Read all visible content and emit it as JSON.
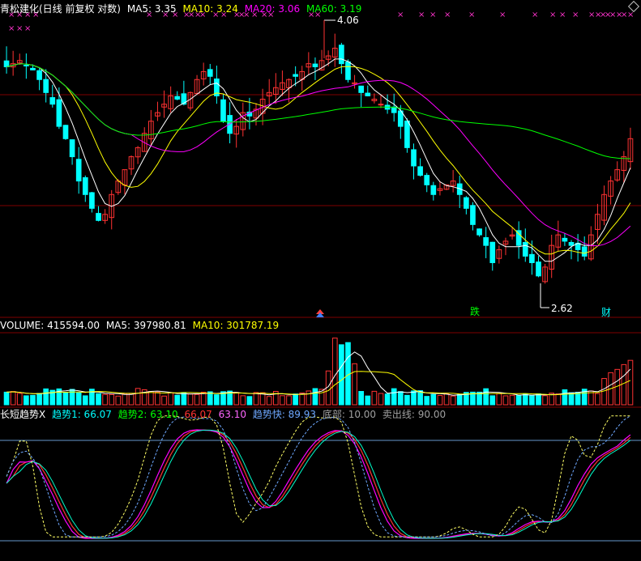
{
  "header": {
    "title": "青松建化(日线 前复权 对数)",
    "ma5": "MA5: 3.35",
    "ma10": "MA10: 3.24",
    "ma20": "MA20: 3.06",
    "ma60": "MA60: 3.19"
  },
  "volume_header": {
    "label": "VOLUME: 415594.00",
    "ma5": "MA5: 397980.81",
    "ma10": "MA10: 301787.19"
  },
  "indicator_header": {
    "name": "长短趋势X",
    "t1": "趋势1: 66.07",
    "t2": "趋势2: 63.10",
    "v1": "66.07",
    "v2": "63.10",
    "fast": "趋势快: 89.93",
    "bottom": "底部: 10.00",
    "sell": "卖出线: 90.00"
  },
  "annotations": {
    "high": "4.06",
    "low": "2.62",
    "die": "跌",
    "cai": "财"
  },
  "colors": {
    "up": "#ff3232",
    "down": "#00ffff",
    "ma5": "#ffffff",
    "ma10": "#ffff00",
    "ma20": "#ff00ff",
    "ma60": "#00ff00",
    "grid": "#800000"
  },
  "chart_data": {
    "type": "candlestick",
    "price_high": 4.06,
    "price_low": 2.62,
    "x_ticks": 120,
    "indicator_levels": {
      "bottom": 10,
      "sell": 90
    },
    "last_values": {
      "ma5": 3.35,
      "ma10": 3.24,
      "ma20": 3.06,
      "ma60": 3.19,
      "volume": 415594.0,
      "vol_ma5": 397980.81,
      "vol_ma10": 301787.19,
      "trend1": 66.07,
      "trend2": 63.1,
      "trend_fast": 89.93
    },
    "closes": [
      3.78,
      3.8,
      3.82,
      3.79,
      3.76,
      3.7,
      3.62,
      3.55,
      3.42,
      3.35,
      3.25,
      3.12,
      3.05,
      2.98,
      2.92,
      2.95,
      3.05,
      3.12,
      3.18,
      3.25,
      3.3,
      3.38,
      3.45,
      3.5,
      3.55,
      3.6,
      3.58,
      3.55,
      3.62,
      3.7,
      3.75,
      3.72,
      3.6,
      3.45,
      3.38,
      3.42,
      3.5,
      3.48,
      3.52,
      3.58,
      3.62,
      3.65,
      3.68,
      3.7,
      3.72,
      3.75,
      3.8,
      3.78,
      3.82,
      3.85,
      3.9,
      3.8,
      3.7,
      3.68,
      3.62,
      3.6,
      3.58,
      3.55,
      3.52,
      3.5,
      3.42,
      3.3,
      3.2,
      3.15,
      3.1,
      3.05,
      3.08,
      3.1,
      3.12,
      3.05,
      2.98,
      2.9,
      2.85,
      2.8,
      2.72,
      2.78,
      2.82,
      2.85,
      2.8,
      2.75,
      2.72,
      2.66,
      2.7,
      2.8,
      2.85,
      2.82,
      2.8,
      2.78,
      2.75,
      2.85,
      2.95,
      3.05,
      3.12,
      3.18,
      3.25,
      3.35
    ]
  }
}
